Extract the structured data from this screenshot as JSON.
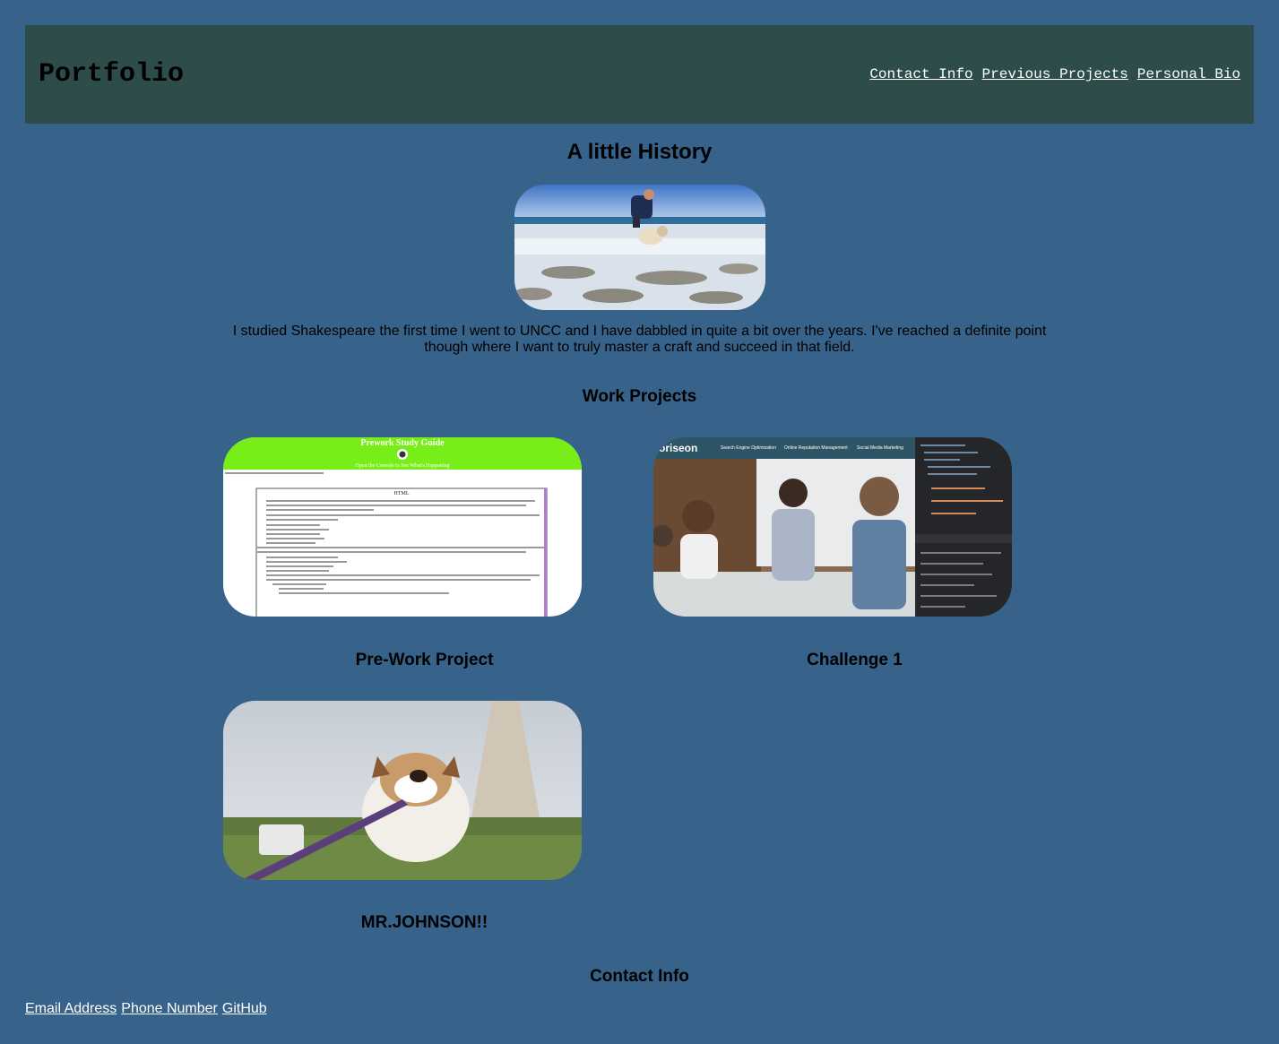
{
  "header": {
    "brand": "Portfolio",
    "nav": [
      "Contact Info",
      "Previous Projects",
      "Personal Bio"
    ]
  },
  "history": {
    "title": "A little History",
    "photo_icon": "beach-dog-photo",
    "bio": "I studied Shakespeare the first time I went to UNCC and I have dabbled in quite a bit over the years. I've reached a definite point though where I want to truly master a craft and succeed in that field."
  },
  "work": {
    "title": "Work Projects",
    "projects": [
      {
        "title": "Pre-Work Project",
        "shot": {
          "banner": "Prework Study Guide",
          "sub": "Open the Console to See What's Happening",
          "heading": "HTML"
        }
      },
      {
        "title": "Challenge 1",
        "shot": {
          "logo": "oriseon",
          "menu": [
            "Search Engine Optimization",
            "Online Reputation Management",
            "Social Media Marketing"
          ]
        }
      },
      {
        "title": "MR.JOHNSON!!",
        "shot": {}
      }
    ]
  },
  "contact": {
    "title": "Contact Info",
    "links": [
      "Email Address",
      "Phone Number",
      "GitHub"
    ]
  },
  "colors": {
    "page_bg": "#37628a",
    "header_bg": "#2e4c4a",
    "prework_banner": "#77ee18"
  }
}
